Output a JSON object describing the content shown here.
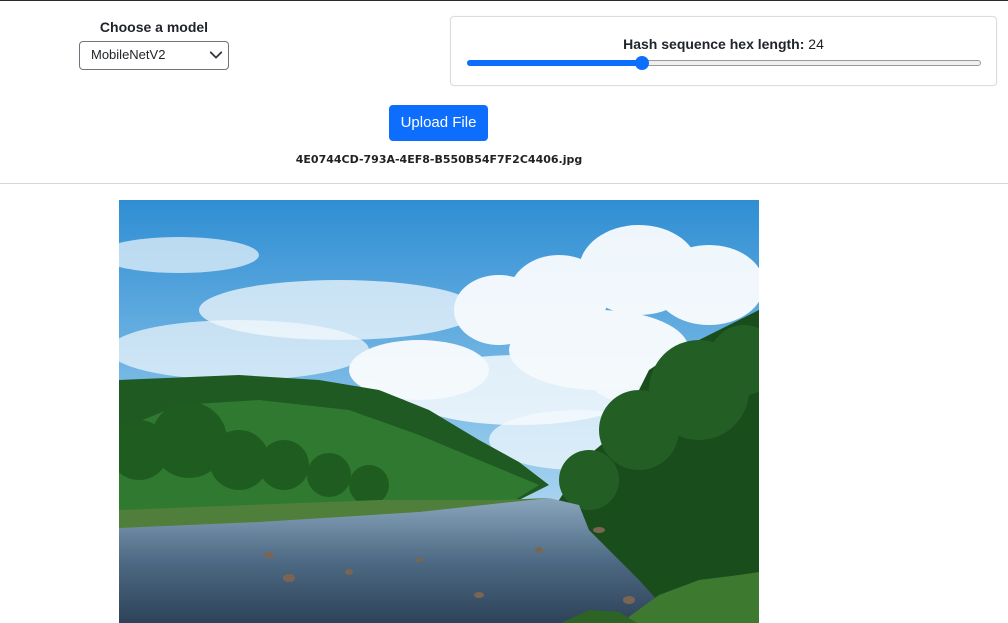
{
  "model": {
    "label": "Choose a model",
    "selected": "MobileNetV2"
  },
  "hash": {
    "label": "Hash sequence hex length:",
    "value": "24",
    "slider_fraction": 0.34
  },
  "upload": {
    "button_label": "Upload File",
    "filename": "4E0744CD-793A-4EF8-B550B54F7F2C4406.jpg"
  },
  "colors": {
    "accent": "#0d6efd"
  },
  "icons": {
    "select": "chevron-down-icon"
  }
}
